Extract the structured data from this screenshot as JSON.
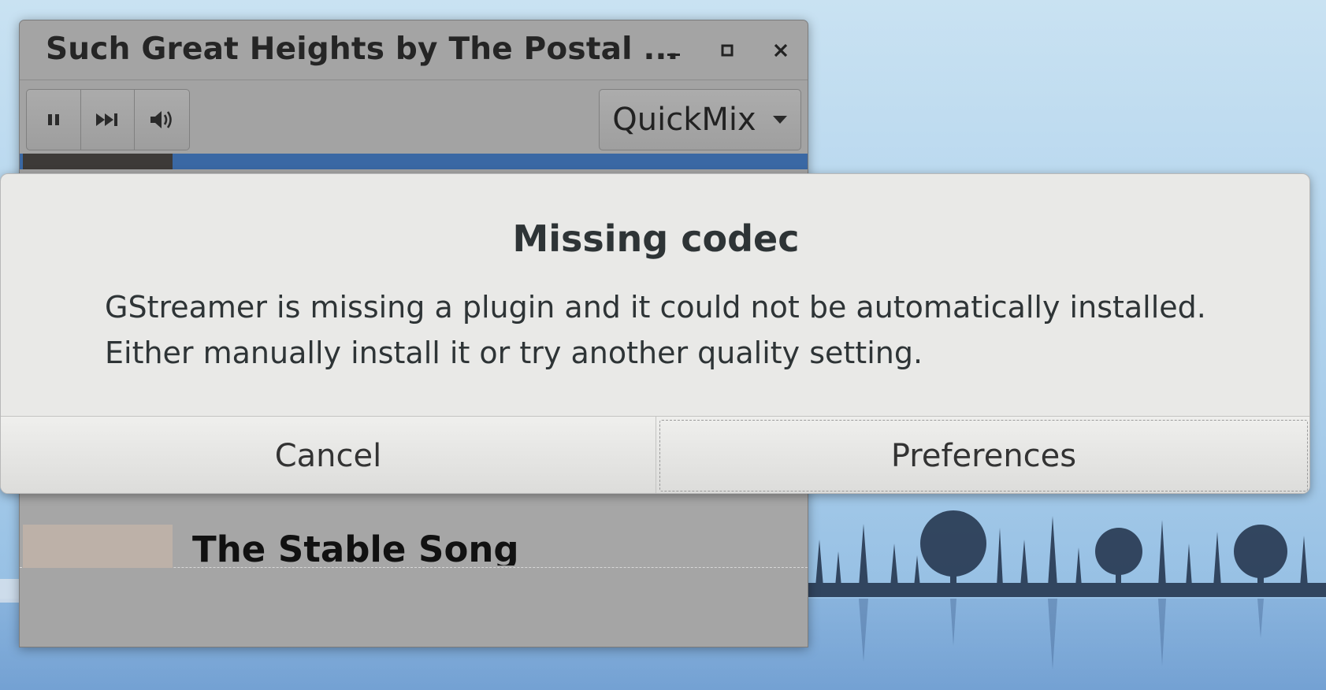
{
  "window": {
    "title": "Such Great Heights by The Postal ...",
    "controls": {
      "minimize_icon": "minimize-icon",
      "maximize_icon": "maximize-icon",
      "close_icon": "close-icon"
    }
  },
  "toolbar": {
    "icons": [
      "pause-icon",
      "skip-next-icon",
      "volume-icon"
    ],
    "station": "QuickMix"
  },
  "playlist": {
    "songs": [
      {
        "title": "The Stable Song"
      }
    ]
  },
  "dialog": {
    "title": "Missing codec",
    "body_line1": "GStreamer is missing a plugin and it could not be automatically installed.",
    "body_line2": "Either manually install it or try another quality setting.",
    "cancel_label": "Cancel",
    "preferences_label": "Preferences"
  },
  "colors": {
    "dialog_bg": "#e9e9e7",
    "window_bg": "#a5a5a5",
    "selection": "#3a68a4",
    "text": "#2e3436"
  }
}
